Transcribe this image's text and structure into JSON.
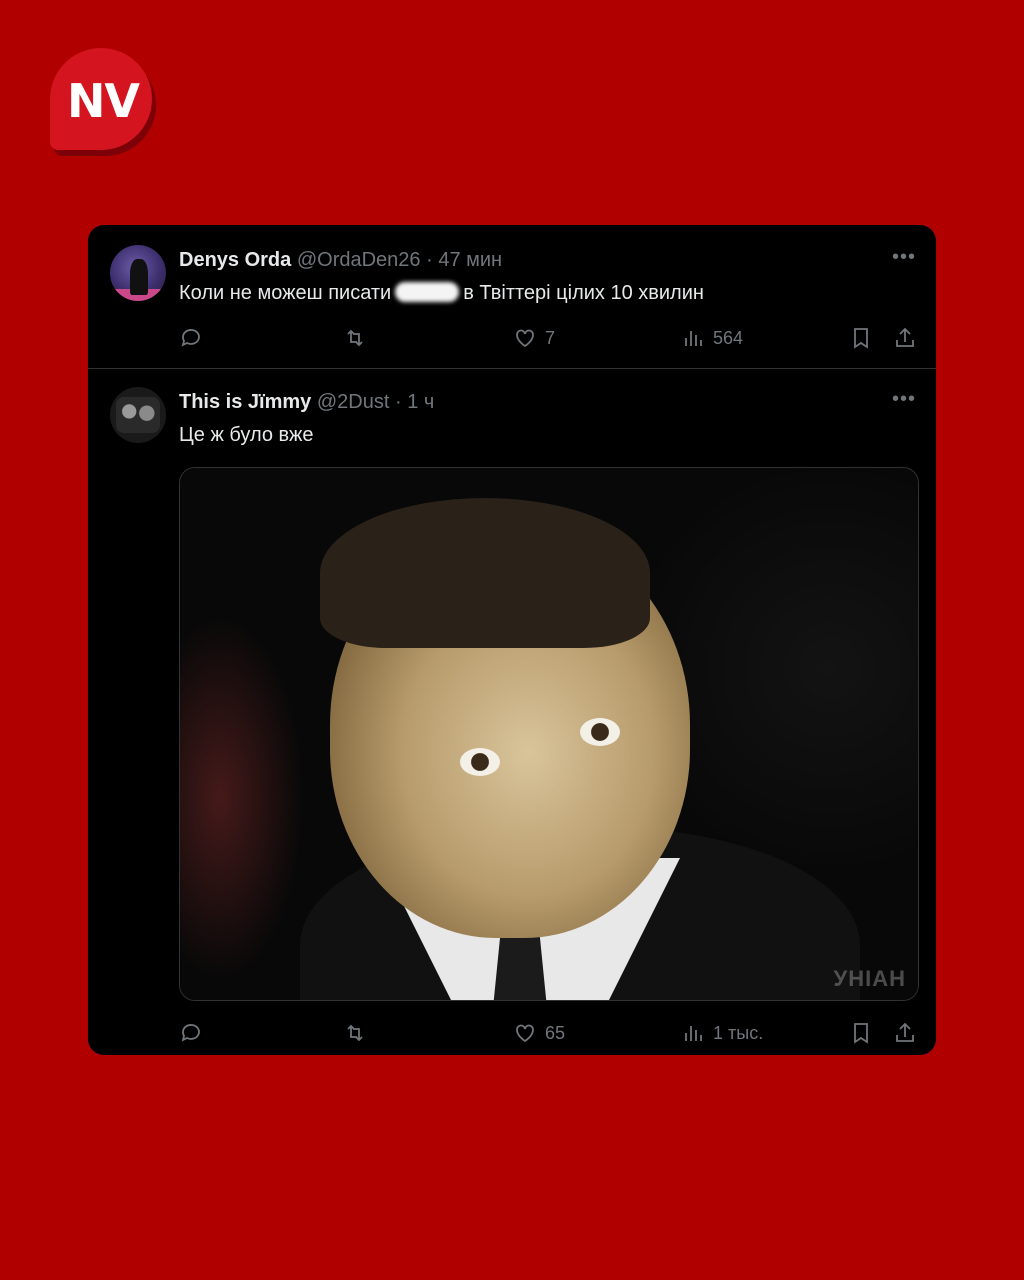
{
  "brand": {
    "logo_text": "NV",
    "accent": "#b00000"
  },
  "tweets": [
    {
      "name": "Denys Orda",
      "handle": "@OrdaDen26",
      "time": "47 мин",
      "text_before": "Коли не можеш писати",
      "text_after": "в Твіттері цілих 10 хвилин",
      "likes": "7",
      "views": "564"
    },
    {
      "name": "This is Jïmmy",
      "handle": "@2Dust",
      "time": "1 ч",
      "text": "Це ж було вже",
      "likes": "65",
      "views": "1 тыс.",
      "media_watermark": "УНІАН"
    }
  ],
  "separator": "·",
  "icons": [
    "reply-icon",
    "retweet-icon",
    "like-icon",
    "views-icon",
    "bookmark-icon",
    "share-icon",
    "more-icon"
  ]
}
